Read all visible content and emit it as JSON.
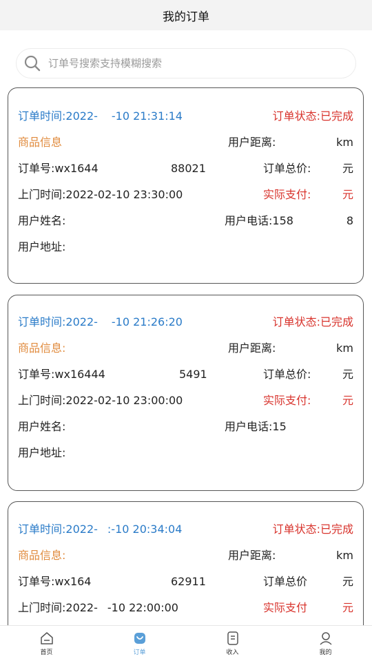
{
  "header": {
    "title": "我的订单"
  },
  "search": {
    "placeholder": "订单号搜索支持模糊搜索"
  },
  "orders": [
    {
      "time_label": "订单时间:",
      "time_value": "2022-",
      "time_value2": "-10 21:31:14",
      "status": "订单状态:已完成",
      "goods_label": "商品信息",
      "distance_label": "用户距离:",
      "distance_unit": "km",
      "order_no_label": "订单号:wx1644",
      "order_no_tail": "88021",
      "total_label": "订单总价:",
      "total_value": "元",
      "visit_time": "上门时间:2022-02-10 23:30:00",
      "paid_label": "实际支付:",
      "paid_value": "元",
      "name_label": "用户姓名:",
      "phone_label": "用户电话:158",
      "phone_tail": "8",
      "address_label": "用户地址:"
    },
    {
      "time_label": "订单时间:",
      "time_value": "2022-",
      "time_value2": "-10 21:26:20",
      "status": "订单状态:已完成",
      "goods_label": "商品信息:",
      "distance_label": "用户距离:",
      "distance_unit": "km",
      "order_no_label": "订单号:wx16444",
      "order_no_tail": "5491",
      "total_label": "订单总价:",
      "total_value": "元",
      "visit_time": "上门时间:2022-02-10 23:00:00",
      "paid_label": "实际支付:",
      "paid_value": "元",
      "name_label": "用户姓名:",
      "phone_label": "用户电话:15",
      "phone_tail": "",
      "address_label": "用户地址:"
    },
    {
      "time_label": "订单时间:",
      "time_value": "2022-",
      "time_value2": ":-10 20:34:04",
      "status": "订单状态:已完成",
      "goods_label": "商品信息:",
      "distance_label": "用户距离:",
      "distance_unit": "km",
      "order_no_label": "订单号:wx164",
      "order_no_tail": "62911",
      "total_label": "订单总价",
      "total_value": "元",
      "visit_time_a": "上门时间:2022-",
      "visit_time_b": "-10 22:00:00",
      "paid_label": "实际支付",
      "paid_value": "元"
    }
  ],
  "tabbar": [
    {
      "label": "首页",
      "icon": "home-icon"
    },
    {
      "label": "订单",
      "icon": "order-icon",
      "active": true
    },
    {
      "label": "收入",
      "icon": "income-icon"
    },
    {
      "label": "我的",
      "icon": "profile-icon"
    }
  ],
  "colors": {
    "blue": "#2a7bc8",
    "red": "#d8332c",
    "orange": "#e08a3c",
    "active_tab": "#5a9fd8"
  }
}
